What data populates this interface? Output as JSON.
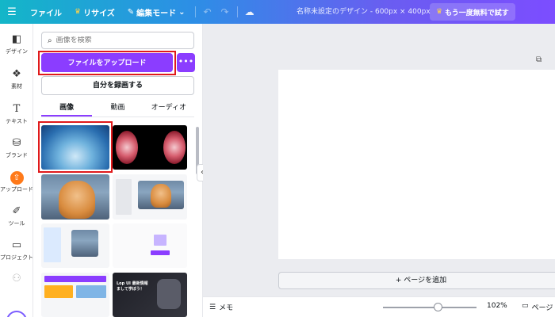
{
  "topbar": {
    "file": "ファイル",
    "resize": "リサイズ",
    "edit_mode": "編集モード",
    "title": "名称未設定のデザイン - 600px × 400px",
    "trial": "もう一度無料で試す"
  },
  "rail": {
    "design": "デザイン",
    "elements": "素材",
    "text": "テキスト",
    "brand": "ブランド",
    "uploads": "アップロード",
    "tools": "ツール",
    "projects": "プロジェクト"
  },
  "panel": {
    "search_placeholder": "画像を検索",
    "upload_button": "ファイルをアップロード",
    "more_button": "•••",
    "record_button": "自分を録画する",
    "tabs": [
      "画像",
      "動画",
      "オーディオ"
    ],
    "active_tab": "画像"
  },
  "thumb_text": {
    "promo_line1": "Lop UI 最新情報",
    "promo_line2": "まして学ぼう！"
  },
  "canvas": {
    "add_page": "+ ページを追加"
  },
  "footer": {
    "memo": "メモ",
    "zoom": "102%",
    "pages": "ページ"
  },
  "colors": {
    "accent": "#8b3dff",
    "highlight": "#e0191b",
    "upload_icon": "#ff7a1a"
  }
}
